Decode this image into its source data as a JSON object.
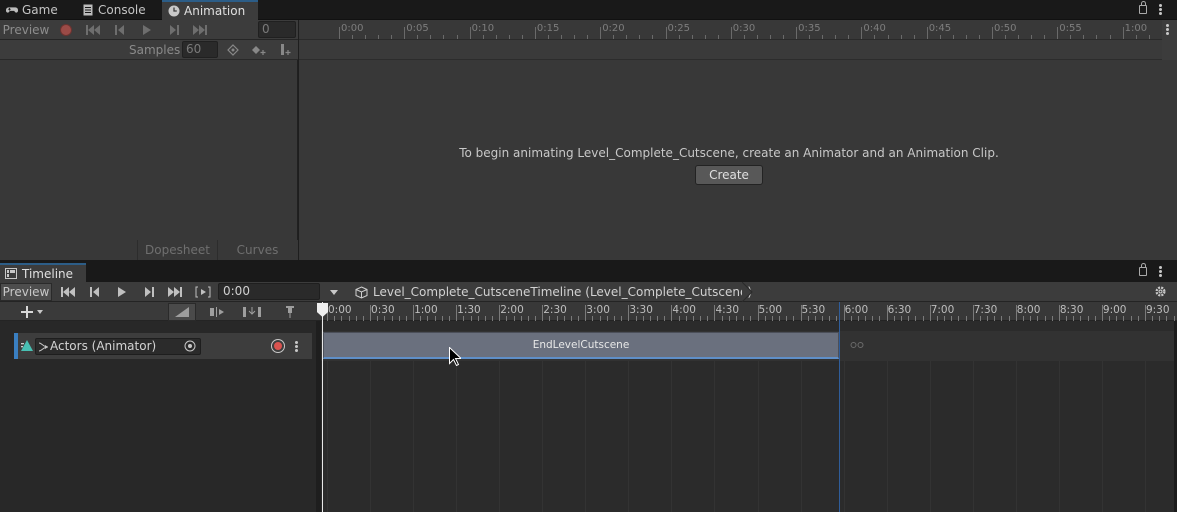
{
  "tabs": {
    "game": "Game",
    "console": "Console",
    "animation": "Animation"
  },
  "animation": {
    "preview": "Preview",
    "frame": "0",
    "samples_label": "Samples",
    "samples_value": "60",
    "ruler_labels": [
      "0:00",
      "0:05",
      "0:10",
      "0:15",
      "0:20",
      "0:25",
      "0:30",
      "0:35",
      "0:40",
      "0:45",
      "0:50",
      "0:55",
      "1:00"
    ],
    "message": "To begin animating Level_Complete_Cutscene, create an Animator and an Animation Clip.",
    "create_label": "Create",
    "dopesheet": "Dopesheet",
    "curves": "Curves"
  },
  "timeline": {
    "tab": "Timeline",
    "preview": "Preview",
    "time": "0:00",
    "breadcrumb": "Level_Complete_CutsceneTimeline (Level_Complete_Cutscene)",
    "ruler_labels": [
      "0:00",
      "0:30",
      "1:00",
      "1:30",
      "2:00",
      "2:30",
      "3:00",
      "3:30",
      "4:00",
      "4:30",
      "5:00",
      "5:30",
      "6:00",
      "6:30",
      "7:00",
      "7:30",
      "8:00",
      "8:30",
      "9:00",
      "9:30"
    ],
    "track_name": "Actors (Animator)",
    "clip_name": "EndLevelCutscene"
  },
  "colors": {
    "accent": "#2c5d87",
    "record": "#d9534f",
    "clip": "#6a707e"
  }
}
